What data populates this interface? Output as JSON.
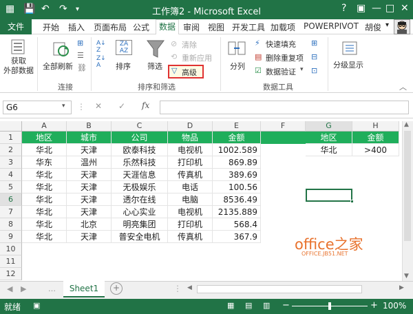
{
  "title": "工作簿2 - Microsoft Excel",
  "window_controls": [
    "?",
    "▣",
    "—",
    "□",
    "✕"
  ],
  "user": "胡俊",
  "colors": {
    "accent": "#217346",
    "header_fill": "#1fae5b",
    "highlight": "#e03131"
  },
  "tabs": [
    "文件",
    "开始",
    "插入",
    "页面布局",
    "公式",
    "数据",
    "审阅",
    "视图",
    "开发工具",
    "加载项",
    "POWERPIVOT"
  ],
  "ribbon": {
    "get_external": "获取\n外部数据",
    "refresh_all": "全部刷新",
    "conn_group": "连接",
    "sort": "排序",
    "filter": "筛选",
    "clear": "清除",
    "reapply": "重新应用",
    "advanced": "高级",
    "sort_filter_group": "排序和筛选",
    "split": "分列",
    "flash_fill": "快速填充",
    "remove_dup": "删除重复项",
    "validation": "数据验证",
    "data_tools_group": "数据工具",
    "outline": "分级显示"
  },
  "name_box": "G6",
  "formula_icon": "fx",
  "columns": [
    "A",
    "B",
    "C",
    "D",
    "E",
    "F",
    "G",
    "H"
  ],
  "rows": [
    "1",
    "2",
    "3",
    "4",
    "5",
    "6",
    "7",
    "8",
    "9",
    "10",
    "11",
    "12"
  ],
  "table": {
    "headers": [
      "地区",
      "城市",
      "公司",
      "物品",
      "金额"
    ],
    "rows": [
      [
        "华北",
        "天津",
        "欧泰科技",
        "电视机",
        "1002.589"
      ],
      [
        "华东",
        "温州",
        "乐然科技",
        "打印机",
        "869.89"
      ],
      [
        "华北",
        "天津",
        "天涯信息",
        "传真机",
        "389.69"
      ],
      [
        "华北",
        "天津",
        "无极娱乐",
        "电话",
        "100.56"
      ],
      [
        "华北",
        "天津",
        "透尔在线",
        "电脑",
        "8536.49"
      ],
      [
        "华北",
        "天津",
        "心心实业",
        "电视机",
        "2135.889"
      ],
      [
        "华北",
        "北京",
        "明亮集团",
        "打印机",
        "568.4"
      ],
      [
        "华北",
        "天津",
        "普安全电机",
        "传真机",
        "367.9"
      ]
    ]
  },
  "criteria": {
    "headers": [
      "地区",
      "金额"
    ],
    "values": [
      "华北",
      ">400"
    ]
  },
  "sheet_tab": "Sheet1",
  "status": {
    "left": "就绪",
    "zoom": "100%"
  },
  "watermark": {
    "main": "office之家",
    "sub": "OFFICE.JB51.NET"
  }
}
